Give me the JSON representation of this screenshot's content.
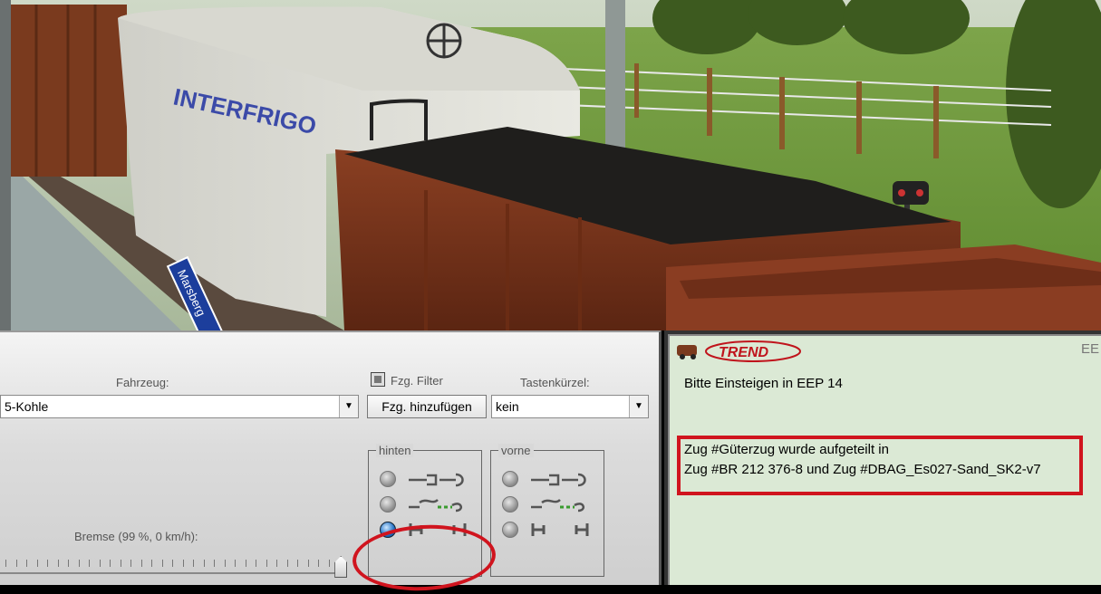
{
  "scene": {
    "station_sign": "Marsberg",
    "wagon_brand": "INTERFRIGO"
  },
  "vehicle_panel": {
    "fahrzeug_label": "Fahrzeug:",
    "vehicle_value": "5-Kohle",
    "filter_label": "Fzg. Filter",
    "add_button": "Fzg. hinzufügen",
    "shortcut_label": "Tastenkürzel:",
    "shortcut_value": "kein",
    "brake_label": "Bremse (99 %, 0 km/h):",
    "brake_level_percent": 99,
    "group_rear_title": "hinten",
    "group_front_title": "vorne",
    "rear_selected_index": 2,
    "front_selected_index": null
  },
  "log_panel": {
    "logo_text": "TREND",
    "corner_text": "EE",
    "welcome": "Bitte Einsteigen in EEP 14",
    "msg_line1": "Zug #Güterzug wurde aufgeteilt in",
    "msg_line2": "Zug #BR 212 376-8 und Zug #DBAG_Es027-Sand_SK2-v7"
  },
  "colors": {
    "highlight_red": "#d0141e",
    "log_bg": "#dbe9d5",
    "radio_selected": "#1e6fc4"
  }
}
